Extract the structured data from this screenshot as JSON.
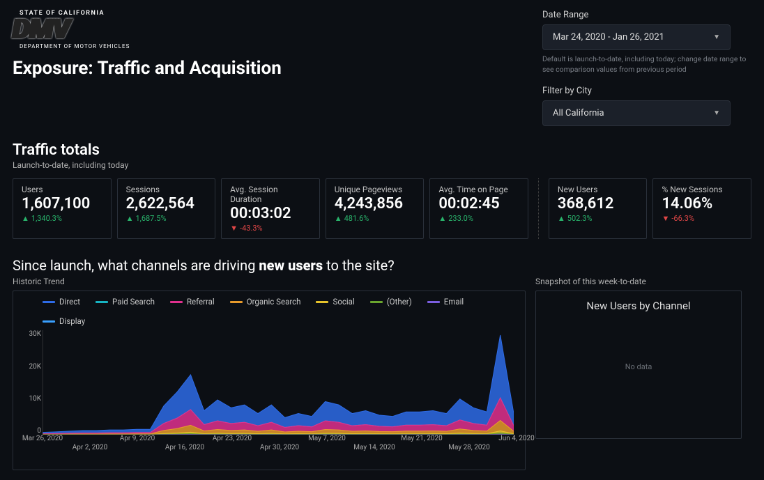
{
  "logo": {
    "top": "STATE OF CALIFORNIA",
    "main": "DMV",
    "sub": "DEPARTMENT OF MOTOR VEHICLES"
  },
  "page_title": "Exposure: Traffic and Acquisition",
  "date_range": {
    "label": "Date Range",
    "value": "Mar 24, 2020 - Jan 26, 2021",
    "hint": "Default is launch-to-date, including today; change date range to see comparison values from previous period"
  },
  "filter": {
    "label": "Filter by City",
    "value": "All California"
  },
  "traffic": {
    "title": "Traffic totals",
    "sub": "Launch-to-date, including today"
  },
  "kpis": [
    {
      "label": "Users",
      "value": "1,607,100",
      "delta": "1,340.3%",
      "dir": "up"
    },
    {
      "label": "Sessions",
      "value": "2,622,564",
      "delta": "1,687.5%",
      "dir": "up"
    },
    {
      "label": "Avg. Session Duration",
      "value": "00:03:02",
      "delta": "-43.3%",
      "dir": "down"
    },
    {
      "label": "Unique Pageviews",
      "value": "4,243,856",
      "delta": "481.6%",
      "dir": "up"
    },
    {
      "label": "Avg. Time on Page",
      "value": "00:02:45",
      "delta": "233.0%",
      "dir": "up"
    }
  ],
  "kpis2": [
    {
      "label": "New Users",
      "value": "368,612",
      "delta": "502.3%",
      "dir": "up"
    },
    {
      "label": "% New Sessions",
      "value": "14.06%",
      "delta": "-66.3%",
      "dir": "down"
    }
  ],
  "channels": {
    "title_pre": "Since launch, what channels are driving ",
    "title_bold": "new users",
    "title_post": " to the site?",
    "left_label": "Historic Trend",
    "right_label": "Snapshot of this week-to-date",
    "right_title": "New Users by Channel",
    "no_data": "No data"
  },
  "chart_data": {
    "type": "area",
    "title": "Historic Trend — New Users by Channel",
    "xlabel": "",
    "ylabel": "",
    "ylim": [
      0,
      30000
    ],
    "yticks": [
      0,
      10000,
      20000,
      30000
    ],
    "ytick_labels": [
      "0",
      "10K",
      "20K",
      "30K"
    ],
    "x_major": [
      "Mar 26, 2020",
      "Apr 9, 2020",
      "Apr 23, 2020",
      "May 7, 2020",
      "May 21, 2020",
      "Jun 4, 2020"
    ],
    "x_minor": [
      "Apr 2, 2020",
      "Apr 16, 2020",
      "Apr 30, 2020",
      "May 14, 2020",
      "May 28, 2020"
    ],
    "categories": [
      "Mar 26",
      "Mar 28",
      "Mar 30",
      "Apr 1",
      "Apr 3",
      "Apr 5",
      "Apr 7",
      "Apr 9",
      "Apr 11",
      "Apr 13",
      "Apr 15",
      "Apr 17",
      "Apr 19",
      "Apr 21",
      "Apr 23",
      "Apr 25",
      "Apr 27",
      "Apr 29",
      "May 1",
      "May 3",
      "May 5",
      "May 7",
      "May 9",
      "May 11",
      "May 13",
      "May 15",
      "May 17",
      "May 19",
      "May 21",
      "May 23",
      "May 25",
      "May 27",
      "May 29",
      "May 31",
      "Jun 2",
      "Jun 4"
    ],
    "series": [
      {
        "name": "Direct",
        "color": "#2e6be6",
        "values": [
          400,
          500,
          600,
          700,
          700,
          800,
          800,
          900,
          900,
          5000,
          7500,
          10000,
          4000,
          6000,
          4500,
          5000,
          3500,
          5000,
          2800,
          3500,
          3000,
          5500,
          5000,
          3500,
          4000,
          3200,
          3000,
          3800,
          3800,
          4000,
          3500,
          6000,
          4500,
          3800,
          18000,
          3500
        ]
      },
      {
        "name": "Paid Search",
        "color": "#17b3c2",
        "values": [
          0,
          0,
          0,
          0,
          0,
          0,
          0,
          0,
          0,
          0,
          0,
          0,
          0,
          0,
          0,
          0,
          0,
          0,
          0,
          0,
          0,
          0,
          0,
          0,
          0,
          0,
          0,
          0,
          0,
          0,
          0,
          0,
          0,
          0,
          0,
          0
        ]
      },
      {
        "name": "Referral",
        "color": "#e0308e",
        "values": [
          150,
          200,
          250,
          300,
          300,
          350,
          350,
          400,
          400,
          2000,
          3000,
          4500,
          1800,
          2500,
          2000,
          2200,
          1600,
          2200,
          1300,
          1600,
          1400,
          2500,
          2200,
          1600,
          1800,
          1500,
          1400,
          1700,
          1700,
          1800,
          1600,
          2600,
          2000,
          1700,
          6500,
          1600
        ]
      },
      {
        "name": "Organic Search",
        "color": "#e79a2b",
        "values": [
          100,
          100,
          120,
          140,
          140,
          160,
          160,
          180,
          180,
          900,
          1300,
          2000,
          800,
          1100,
          900,
          1000,
          720,
          1000,
          580,
          720,
          630,
          1100,
          1000,
          720,
          800,
          680,
          630,
          770,
          770,
          810,
          720,
          1200,
          900,
          770,
          3000,
          720
        ]
      },
      {
        "name": "Social",
        "color": "#e7c32b",
        "values": [
          20,
          20,
          25,
          30,
          30,
          35,
          35,
          40,
          40,
          200,
          280,
          430,
          180,
          240,
          200,
          220,
          160,
          220,
          130,
          160,
          140,
          240,
          220,
          160,
          180,
          150,
          140,
          170,
          170,
          180,
          160,
          260,
          200,
          170,
          650,
          160
        ]
      },
      {
        "name": "(Other)",
        "color": "#6aa52e",
        "values": [
          10,
          10,
          12,
          14,
          14,
          16,
          16,
          18,
          18,
          90,
          130,
          200,
          80,
          110,
          90,
          100,
          72,
          100,
          58,
          72,
          63,
          110,
          100,
          72,
          80,
          68,
          63,
          77,
          77,
          81,
          72,
          120,
          90,
          77,
          300,
          72
        ]
      },
      {
        "name": "Email",
        "color": "#7b5ee0",
        "values": [
          5,
          5,
          6,
          7,
          7,
          8,
          8,
          9,
          9,
          45,
          65,
          100,
          40,
          55,
          45,
          50,
          36,
          50,
          29,
          36,
          31,
          55,
          50,
          36,
          40,
          34,
          31,
          38,
          38,
          40,
          36,
          60,
          45,
          38,
          150,
          36
        ]
      },
      {
        "name": "Display",
        "color": "#3aa0ff",
        "values": [
          0,
          0,
          0,
          0,
          0,
          0,
          0,
          0,
          0,
          0,
          0,
          0,
          0,
          0,
          0,
          0,
          0,
          0,
          0,
          0,
          0,
          0,
          0,
          0,
          0,
          0,
          0,
          0,
          0,
          0,
          0,
          0,
          0,
          0,
          0,
          0
        ]
      }
    ]
  }
}
